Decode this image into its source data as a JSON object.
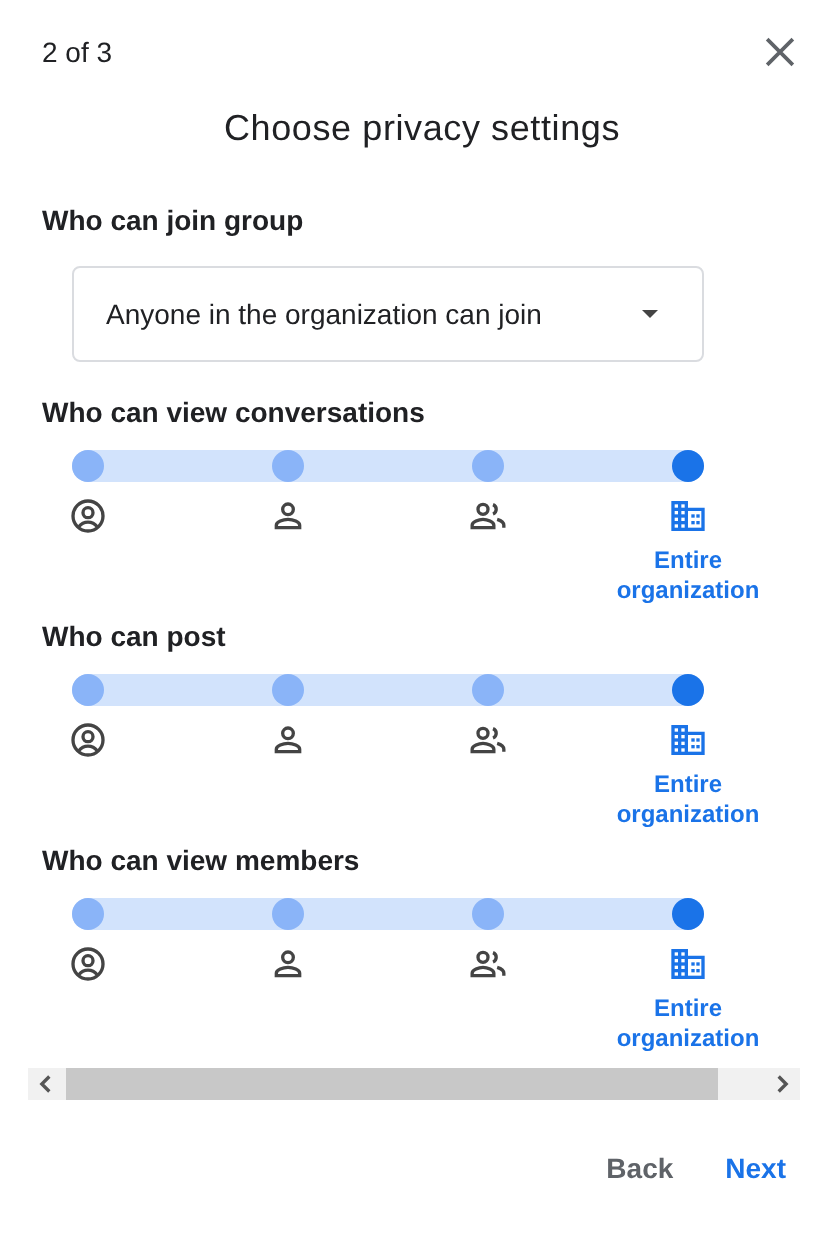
{
  "step": "2 of 3",
  "title": "Choose privacy settings",
  "join": {
    "label": "Who can join group",
    "value": "Anyone in the organization can join"
  },
  "sliders": [
    {
      "label": "Who can view conversations",
      "options": [
        {
          "kind": "owner",
          "selected": false
        },
        {
          "kind": "manager",
          "selected": false
        },
        {
          "kind": "members",
          "selected": false
        },
        {
          "kind": "organization",
          "selected": true,
          "text": "Entire organization"
        }
      ]
    },
    {
      "label": "Who can post",
      "options": [
        {
          "kind": "owner",
          "selected": false
        },
        {
          "kind": "manager",
          "selected": false
        },
        {
          "kind": "members",
          "selected": false
        },
        {
          "kind": "organization",
          "selected": true,
          "text": "Entire organization"
        }
      ]
    },
    {
      "label": "Who can view members",
      "options": [
        {
          "kind": "owner",
          "selected": false
        },
        {
          "kind": "manager",
          "selected": false
        },
        {
          "kind": "members",
          "selected": false
        },
        {
          "kind": "organization",
          "selected": true,
          "text": "Entire organization"
        }
      ]
    }
  ],
  "buttons": [
    {
      "label": "Back",
      "kind": "secondary"
    },
    {
      "label": "Next",
      "kind": "primary"
    }
  ]
}
